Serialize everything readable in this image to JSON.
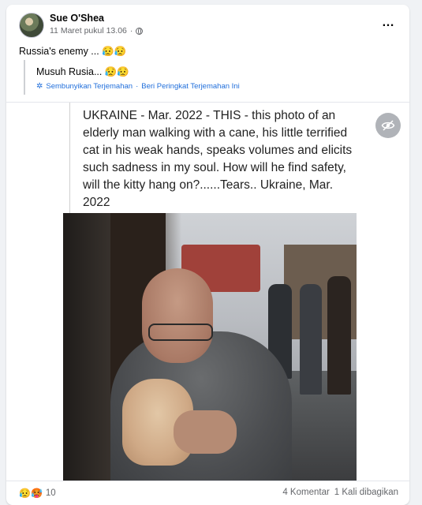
{
  "post": {
    "author": "Sue O'Shea",
    "timestamp": "11 Maret pukul 13.06",
    "dot": "·",
    "privacy_icon": "globe-icon",
    "text": "Russia's enemy ... 😥😥",
    "more_icon": "…"
  },
  "translation": {
    "text": "Musuh Rusia... 😥😥",
    "hide_label": "Sembunyikan Terjemahan",
    "sep": "·",
    "rate_label": "Beri Peringkat Terjemahan Ini"
  },
  "media": {
    "caption": "UKRAINE - Mar. 2022 - THIS - this photo of an elderly man walking with a cane, his little terrified cat in his weak hands, speaks volumes and elicits such sadness in my soul. How will he find safety, will the kitty hang on?......Tears..  Ukraine, Mar. 2022",
    "hide_icon": "eye-slash-icon"
  },
  "footer": {
    "reaction_emojis": "😥🥵",
    "reaction_count": "10",
    "comments": "4 Komentar",
    "shares": "1 Kali dibagikan"
  },
  "colors": {
    "link": "#216fdb",
    "muted": "#65676b",
    "background": "#f0f2f5"
  }
}
